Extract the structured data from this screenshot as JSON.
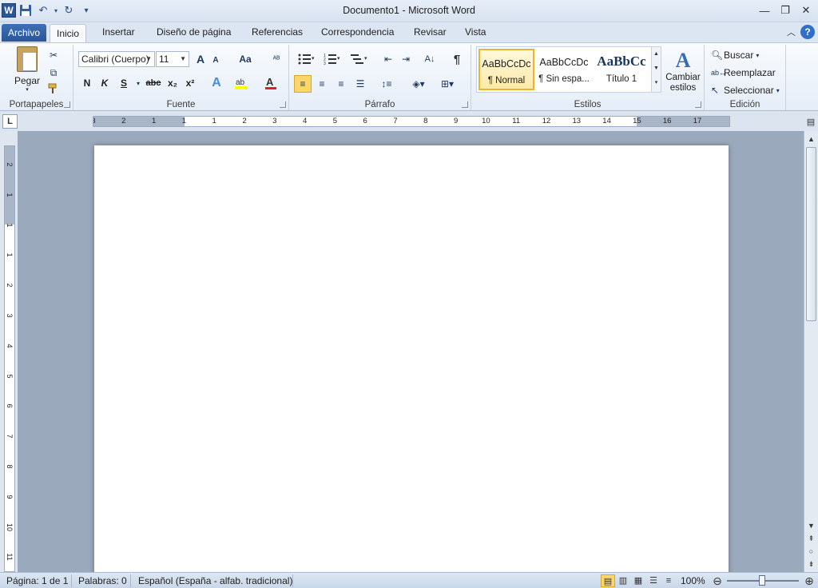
{
  "window": {
    "title": "Documento1  -  Microsoft Word",
    "app_icon": "W",
    "controls": [
      "minimize-icon",
      "restore-icon",
      "close-icon"
    ]
  },
  "qat": {
    "icons": [
      "save-icon",
      "undo-icon",
      "redo-icon",
      "customize-qat-icon"
    ]
  },
  "tabs": [
    "Archivo",
    "Inicio",
    "Insertar",
    "Diseño de página",
    "Referencias",
    "Correspondencia",
    "Revisar",
    "Vista"
  ],
  "active_tab": "Inicio",
  "ribbon": {
    "portapapeles": {
      "label": "Portapapeles",
      "paste_label": "Pegar",
      "icons": [
        "cut-icon",
        "copy-icon",
        "format-painter-icon"
      ]
    },
    "fuente": {
      "label": "Fuente",
      "font_name": "Calibri (Cuerpo)",
      "font_size": "11",
      "buttons": {
        "bold": "N",
        "italic": "K",
        "underline": "S",
        "strike": "abc",
        "subscript": "x₂",
        "superscript": "x²",
        "grow": "A",
        "shrink": "A",
        "change_case": "Aa"
      }
    },
    "parrafo": {
      "label": "Párrafo"
    },
    "estilos": {
      "label": "Estilos",
      "gallery": [
        {
          "sample": "AaBbCcDc",
          "name": "¶ Normal"
        },
        {
          "sample": "AaBbCcDc",
          "name": "¶ Sin espa..."
        },
        {
          "sample": "AaBbCc",
          "name": "Título 1"
        }
      ],
      "change_styles": "Cambiar estilos"
    },
    "edicion": {
      "label": "Edición",
      "find": "Buscar",
      "replace": "Reemplazar",
      "select": "Seleccionar"
    }
  },
  "ruler": {
    "h_numbers": [
      "3",
      "2",
      "1",
      "1",
      "1",
      "2",
      "3",
      "4",
      "5",
      "6",
      "7",
      "8",
      "9",
      "10",
      "11",
      "12",
      "13",
      "14",
      "15",
      "16",
      "17"
    ],
    "v_numbers": [
      "2",
      "1",
      "1",
      "1",
      "2",
      "3",
      "4",
      "5",
      "6",
      "7",
      "8",
      "9",
      "10",
      "11"
    ],
    "tab_selector": "L"
  },
  "status": {
    "page": "Página: 1 de 1",
    "words": "Palabras: 0",
    "language": "Español (España - alfab. tradicional)",
    "zoom": "100%"
  },
  "colors": {
    "accent": "#2b579a",
    "ribbon_bg": "#e5edf7",
    "workspace": "#9ba9bd",
    "selected_style": "#fde9a8"
  }
}
